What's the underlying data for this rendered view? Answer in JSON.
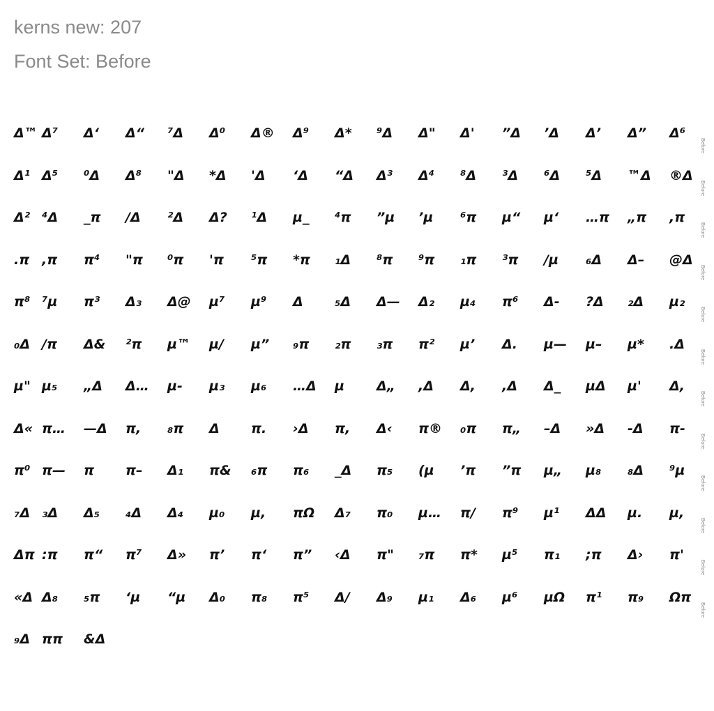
{
  "header": {
    "kerns_line": "kerns new: 207",
    "font_set_line": "Font Set: Before"
  },
  "side_label": "Before",
  "rows": [
    [
      "Δ™",
      "Δ⁷",
      "Δ‘",
      "Δ“",
      "⁷Δ",
      "Δ⁰",
      "Δ®",
      "Δ⁹",
      "Δ*",
      "⁹Δ",
      "Δ\"",
      "Δ'",
      "”Δ",
      "’Δ",
      "Δ’",
      "Δ”",
      "Δ⁶"
    ],
    [
      "Δ¹",
      "Δ⁵",
      "⁰Δ",
      "Δ⁸",
      "\"Δ",
      "*Δ",
      "'Δ",
      "‘Δ",
      "“Δ",
      "Δ³",
      "Δ⁴",
      "⁸Δ",
      "³Δ",
      "⁶Δ",
      "⁵Δ",
      "™Δ",
      "®Δ"
    ],
    [
      "Δ²",
      "⁴Δ",
      "_π",
      "/Δ",
      "²Δ",
      "Δ?",
      "¹Δ",
      "µ_",
      "⁴π",
      "”µ",
      "’µ",
      "⁶π",
      "µ“",
      "µ‘",
      "…π",
      "„π",
      ",π"
    ],
    [
      ".π",
      ",π",
      "π⁴",
      "\"π",
      "⁰π",
      "'π",
      "⁵π",
      "*π",
      "₁Δ",
      "⁸π",
      "⁹π",
      "₁π",
      "³π",
      "/µ",
      "₆Δ",
      "Δ–",
      "@Δ"
    ],
    [
      "π⁸",
      "⁷µ",
      "π³",
      "Δ₃",
      "Δ@",
      "µ⁷",
      "µ⁹",
      "Δ",
      "₅Δ",
      "Δ—",
      "Δ₂",
      "µ₄",
      "π⁶",
      "Δ-",
      "?Δ",
      "₂Δ",
      "µ₂"
    ],
    [
      "₀Δ",
      "/π",
      "Δ&",
      "²π",
      "µ™",
      "µ/",
      "µ”",
      "₉π",
      "₂π",
      "₃π",
      "π²",
      "µ’",
      "Δ.",
      "µ—",
      "µ–",
      "µ*",
      ".Δ"
    ],
    [
      "µ\"",
      "µ₅",
      "„Δ",
      "Δ…",
      "µ-",
      "µ₃",
      "µ₆",
      "…Δ",
      "µ",
      "Δ„",
      ",Δ",
      "Δ,",
      ",Δ",
      "Δ_",
      "µΔ",
      "µ'",
      "Δ,"
    ],
    [
      "Δ«",
      "π…",
      "—Δ",
      "π,",
      "₈π",
      "Δ",
      "π.",
      "›Δ",
      "π,",
      "Δ‹",
      "π®",
      "₀π",
      "π„",
      "–Δ",
      "»Δ",
      "-Δ",
      "π-"
    ],
    [
      "π⁰",
      "π—",
      "π",
      "π–",
      "Δ₁",
      "π&",
      "₆π",
      "π₆",
      "_Δ",
      "π₅",
      "(µ",
      "’π",
      "”π",
      "µ„",
      "µ₈",
      "₈Δ",
      "⁹µ"
    ],
    [
      "₇Δ",
      "₃Δ",
      "Δ₅",
      "₄Δ",
      "Δ₄",
      "µ₀",
      "µ,",
      "πΩ",
      "Δ₇",
      "π₀",
      "µ…",
      "π/",
      "π⁹",
      "µ¹",
      "ΔΔ",
      "µ.",
      "µ,"
    ],
    [
      "Δπ",
      ":π",
      "π“",
      "π⁷",
      "Δ»",
      "π’",
      "π‘",
      "π”",
      "‹Δ",
      "π\"",
      "₇π",
      "π*",
      "µ⁵",
      "π₁",
      ";π",
      "Δ›",
      "π'"
    ],
    [
      "«Δ",
      "Δ₈",
      "₅π",
      "‘µ",
      "“µ",
      "Δ₀",
      "π₈",
      "π⁵",
      "Δ/",
      "Δ₉",
      "µ₁",
      "Δ₆",
      "µ⁶",
      "µΩ",
      "π¹",
      "π₉",
      "Ωπ"
    ],
    [
      "₉Δ",
      "ππ",
      "&Δ"
    ]
  ]
}
